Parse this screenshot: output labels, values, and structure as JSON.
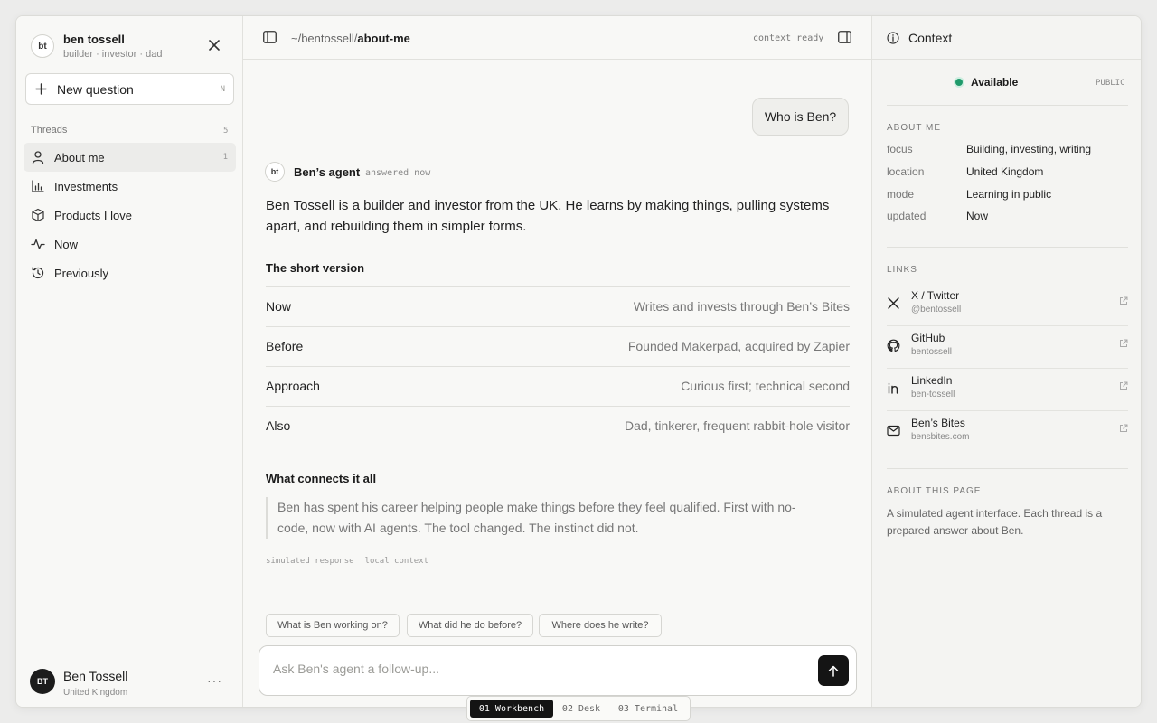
{
  "sidebar": {
    "avatar_initials": "bt",
    "name": "ben tossell",
    "tagline": "builder · investor · dad",
    "new_question": {
      "label": "New question",
      "shortcut": "N"
    },
    "threads_label": "Threads",
    "threads_count": "5",
    "items": [
      {
        "label": "About me",
        "icon": "user-icon",
        "count": "1",
        "active": true
      },
      {
        "label": "Investments",
        "icon": "bar-chart-icon",
        "count": "",
        "active": false
      },
      {
        "label": "Products I love",
        "icon": "box-icon",
        "count": "",
        "active": false
      },
      {
        "label": "Now",
        "icon": "activity-icon",
        "count": "",
        "active": false
      },
      {
        "label": "Previously",
        "icon": "history-icon",
        "count": "",
        "active": false
      }
    ],
    "footer": {
      "initials": "BT",
      "name": "Ben Tossell",
      "location": "United Kingdom",
      "more": "···"
    }
  },
  "topbar": {
    "path_prefix": "~/bentossell/",
    "path_current": "about-me",
    "context_status": "context ready"
  },
  "chat": {
    "user_message": "Who is Ben?",
    "agent_initials": "bt",
    "agent_name": "Ben’s agent",
    "agent_time": "answered now",
    "answer": "Ben Tossell is a builder and investor from the UK. He learns by making things, pulling systems apart, and rebuilding them in simpler forms.",
    "short_heading": "The short version",
    "rows": [
      {
        "key": "Now",
        "value": "Writes and invests through Ben’s Bites"
      },
      {
        "key": "Before",
        "value": "Founded Makerpad, acquired by Zapier"
      },
      {
        "key": "Approach",
        "value": "Curious first; technical second"
      },
      {
        "key": "Also",
        "value": "Dad, tinkerer, frequent rabbit-hole visitor"
      }
    ],
    "connects_heading": "What connects it all",
    "quote": "Ben has spent his career helping people make things before they feel qualified. First with no-code, now with AI agents. The tool changed. The instinct did not.",
    "meta": [
      "simulated response",
      "local context"
    ],
    "suggestions": [
      "What is Ben working on?",
      "What did he do before?",
      "Where does he write?"
    ],
    "input_placeholder": "Ask Ben's agent a follow-up..."
  },
  "context": {
    "title": "Context",
    "status": "Available",
    "visibility": "PUBLIC",
    "about_heading": "ABOUT ME",
    "about": [
      {
        "key": "focus",
        "value": "Building, investing, writing"
      },
      {
        "key": "location",
        "value": "United Kingdom"
      },
      {
        "key": "mode",
        "value": "Learning in public"
      },
      {
        "key": "updated",
        "value": "Now"
      }
    ],
    "links_heading": "LINKS",
    "links": [
      {
        "name": "X / Twitter",
        "handle": "@bentossell",
        "icon": "x-icon"
      },
      {
        "name": "GitHub",
        "handle": "bentossell",
        "icon": "github-icon"
      },
      {
        "name": "LinkedIn",
        "handle": "ben-tossell",
        "icon": "linkedin-icon"
      },
      {
        "name": "Ben’s Bites",
        "handle": "bensbites.com",
        "icon": "mail-icon"
      }
    ],
    "page_heading": "ABOUT THIS PAGE",
    "page_text": "A simulated agent interface. Each thread is a prepared answer about Ben."
  },
  "bottom_tabs": [
    {
      "label": "01 Workbench",
      "active": true
    },
    {
      "label": "02 Desk",
      "active": false
    },
    {
      "label": "03 Terminal",
      "active": false
    }
  ],
  "colors": {
    "status_green": "#1f9a6b",
    "primary_dark": "#141414"
  }
}
